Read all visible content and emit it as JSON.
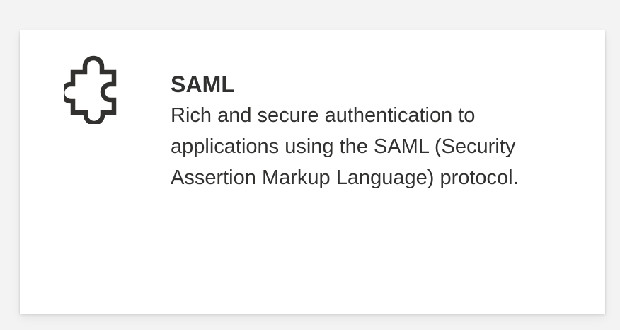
{
  "card": {
    "icon": "puzzle-piece-icon",
    "title": "SAML",
    "description": "Rich and secure authentication to applications using the SAML (Security Assertion Markup Language) protocol."
  },
  "colors": {
    "text": "#323130",
    "card_background": "#ffffff",
    "page_background": "#f3f3f3"
  }
}
